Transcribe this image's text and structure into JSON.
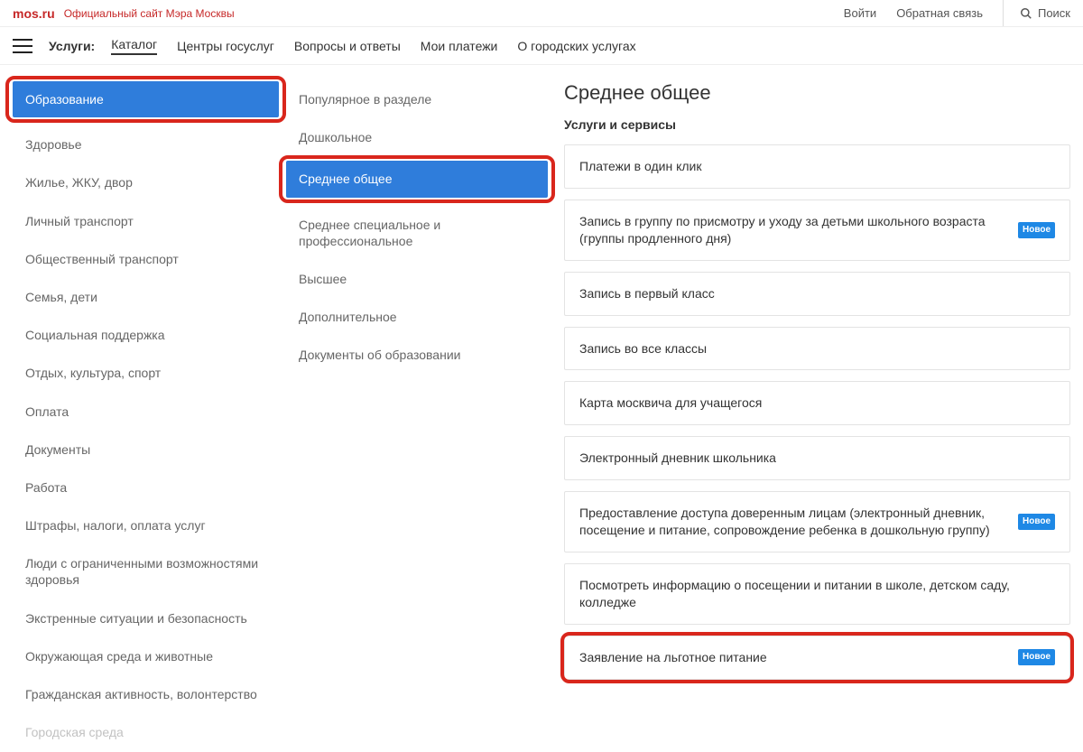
{
  "header": {
    "logo": "mos.ru",
    "subtitle": "Официальный сайт Мэра Москвы",
    "login": "Войти",
    "feedback": "Обратная связь",
    "search": "Поиск"
  },
  "nav": {
    "label": "Услуги:",
    "items": [
      "Каталог",
      "Центры госуслуг",
      "Вопросы и ответы",
      "Мои платежи",
      "О городских услугах"
    ],
    "active_index": 0
  },
  "categories": {
    "items": [
      "Образование",
      "Здоровье",
      "Жилье, ЖКУ, двор",
      "Личный транспорт",
      "Общественный транспорт",
      "Семья, дети",
      "Социальная поддержка",
      "Отдых, культура, спорт",
      "Оплата",
      "Документы",
      "Работа",
      "Штрафы, налоги, оплата услуг",
      "Люди с ограниченными возможностями здоровья",
      "Экстренные ситуации и безопасность",
      "Окружающая среда и животные",
      "Гражданская активность, волонтерство",
      "Городская среда"
    ],
    "selected_index": 0
  },
  "subcategories": {
    "items": [
      "Популярное в разделе",
      "Дошкольное",
      "Среднее общее",
      "Среднее специальное и профессиональное",
      "Высшее",
      "Дополнительное",
      "Документы об образовании"
    ],
    "selected_index": 2
  },
  "content": {
    "title": "Среднее общее",
    "subtitle": "Услуги и сервисы",
    "badge_text": "Новое",
    "services": [
      {
        "label": "Платежи в один клик",
        "badge": false
      },
      {
        "label": "Запись в группу по присмотру и уходу за детьми школьного возраста (группы продленного дня)",
        "badge": true
      },
      {
        "label": "Запись в первый класс",
        "badge": false
      },
      {
        "label": "Запись во все классы",
        "badge": false
      },
      {
        "label": "Карта москвича для учащегося",
        "badge": false
      },
      {
        "label": "Электронный дневник школьника",
        "badge": false
      },
      {
        "label": "Предоставление доступа доверенным лицам (электронный дневник, посещение и питание, сопровождение ребенка в дошкольную группу)",
        "badge": true
      },
      {
        "label": "Посмотреть информацию о посещении и питании в школе, детском саду, колледже",
        "badge": false
      },
      {
        "label": "Заявление на льготное питание",
        "badge": true
      }
    ],
    "highlight_index": 8
  }
}
